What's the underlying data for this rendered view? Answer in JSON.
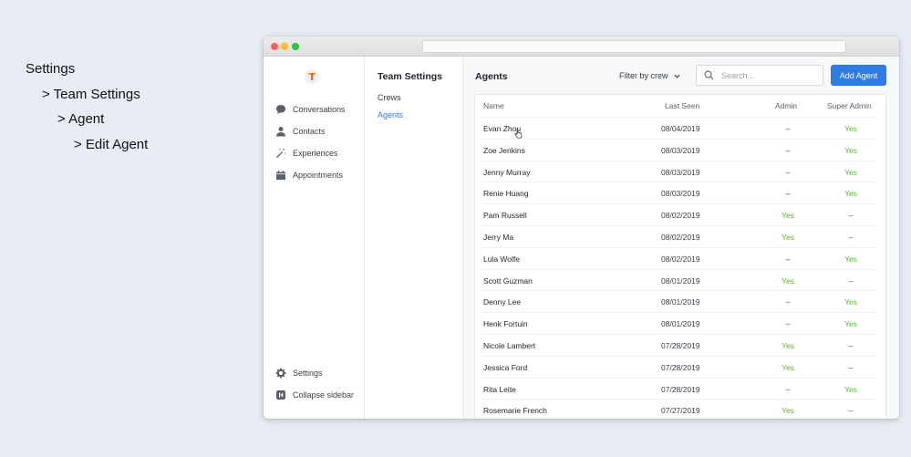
{
  "breadcrumb": [
    "Settings",
    "> Team Settings",
    "> Agent",
    "> Edit Agent"
  ],
  "sidebar": {
    "items": [
      {
        "label": "Conversations",
        "icon": "chat-bubble-icon"
      },
      {
        "label": "Contacts",
        "icon": "person-icon"
      },
      {
        "label": "Experiences",
        "icon": "magic-wand-icon"
      },
      {
        "label": "Appointments",
        "icon": "calendar-icon"
      }
    ],
    "bottom": [
      {
        "label": "Settings",
        "icon": "gear-icon"
      },
      {
        "label": "Collapse sidebar",
        "icon": "collapse-icon"
      }
    ]
  },
  "subnav": {
    "title": "Team Settings",
    "items": [
      {
        "label": "Crews",
        "active": false
      },
      {
        "label": "Agents",
        "active": true
      }
    ]
  },
  "main": {
    "title": "Agents",
    "filter_label": "Filter by crew",
    "search_placeholder": "Search...",
    "add_button": "Add Agent",
    "columns": [
      "Name",
      "Last Seen",
      "Admin",
      "Super Admin"
    ],
    "rows": [
      {
        "name": "Evan Zhou",
        "last_seen": "08/04/2019",
        "admin": "–",
        "super_admin": "Yes"
      },
      {
        "name": "Zoe Jenkins",
        "last_seen": "08/03/2019",
        "admin": "–",
        "super_admin": "Yes"
      },
      {
        "name": "Jenny Murray",
        "last_seen": "08/03/2019",
        "admin": "–",
        "super_admin": "Yes"
      },
      {
        "name": "Renie Huang",
        "last_seen": "08/03/2019",
        "admin": "–",
        "super_admin": "Yes"
      },
      {
        "name": "Pam Russell",
        "last_seen": "08/02/2019",
        "admin": "Yes",
        "super_admin": "–"
      },
      {
        "name": "Jerry Ma",
        "last_seen": "08/02/2019",
        "admin": "Yes",
        "super_admin": "–"
      },
      {
        "name": "Lula Wolfe",
        "last_seen": "08/02/2019",
        "admin": "–",
        "super_admin": "Yes"
      },
      {
        "name": "Scott Guzman",
        "last_seen": "08/01/2019",
        "admin": "Yes",
        "super_admin": "–"
      },
      {
        "name": "Denny Lee",
        "last_seen": "08/01/2019",
        "admin": "–",
        "super_admin": "Yes"
      },
      {
        "name": "Henk Fortuin",
        "last_seen": "08/01/2019",
        "admin": "–",
        "super_admin": "Yes"
      },
      {
        "name": "Nicole Lambert",
        "last_seen": "07/28/2019",
        "admin": "Yes",
        "super_admin": "–"
      },
      {
        "name": "Jessica Ford",
        "last_seen": "07/28/2019",
        "admin": "Yes",
        "super_admin": "–"
      },
      {
        "name": "Rita Leite",
        "last_seen": "07/28/2019",
        "admin": "–",
        "super_admin": "Yes"
      },
      {
        "name": "Rosemarie French",
        "last_seen": "07/27/2019",
        "admin": "Yes",
        "super_admin": "–"
      }
    ]
  },
  "colors": {
    "accent": "#2d7be5",
    "yes": "#5cb82a",
    "background": "#e8ecf4"
  }
}
